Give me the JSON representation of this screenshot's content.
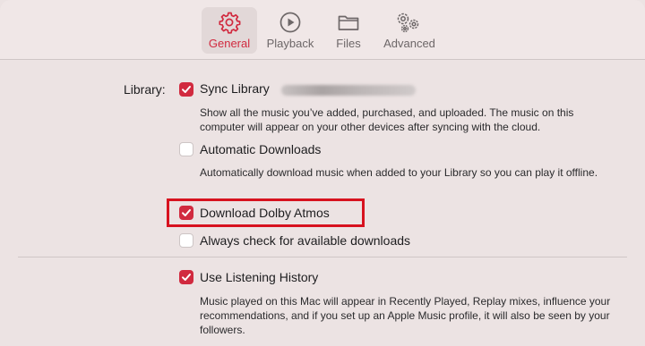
{
  "toolbar": {
    "tabs": [
      {
        "label": "General",
        "icon": "gear-icon",
        "active": true
      },
      {
        "label": "Playback",
        "icon": "play-circle-icon",
        "active": false
      },
      {
        "label": "Files",
        "icon": "folder-icon",
        "active": false
      },
      {
        "label": "Advanced",
        "icon": "gears-icon",
        "active": false
      }
    ]
  },
  "library": {
    "section_label": "Library:",
    "sync_library": {
      "label": "Sync Library",
      "checked": true,
      "description": "Show all the music you’ve added, purchased, and uploaded. The music on this computer will appear on your other devices after syncing with the cloud."
    },
    "automatic_downloads": {
      "label": "Automatic Downloads",
      "checked": false,
      "description": "Automatically download music when added to your Library so you can play it offline."
    },
    "download_dolby_atmos": {
      "label": "Download Dolby Atmos",
      "checked": true
    },
    "always_check": {
      "label": "Always check for available downloads",
      "checked": false
    }
  },
  "listening_history": {
    "label": "Use Listening History",
    "checked": true,
    "description": "Music played on this Mac will appear in Recently Played, Replay mixes, influence your recommendations, and if you set up an Apple Music profile, it will also be seen by your followers."
  },
  "colors": {
    "accent": "#d12a3f",
    "highlight_box": "#d7121f",
    "background": "#ece3e3"
  }
}
